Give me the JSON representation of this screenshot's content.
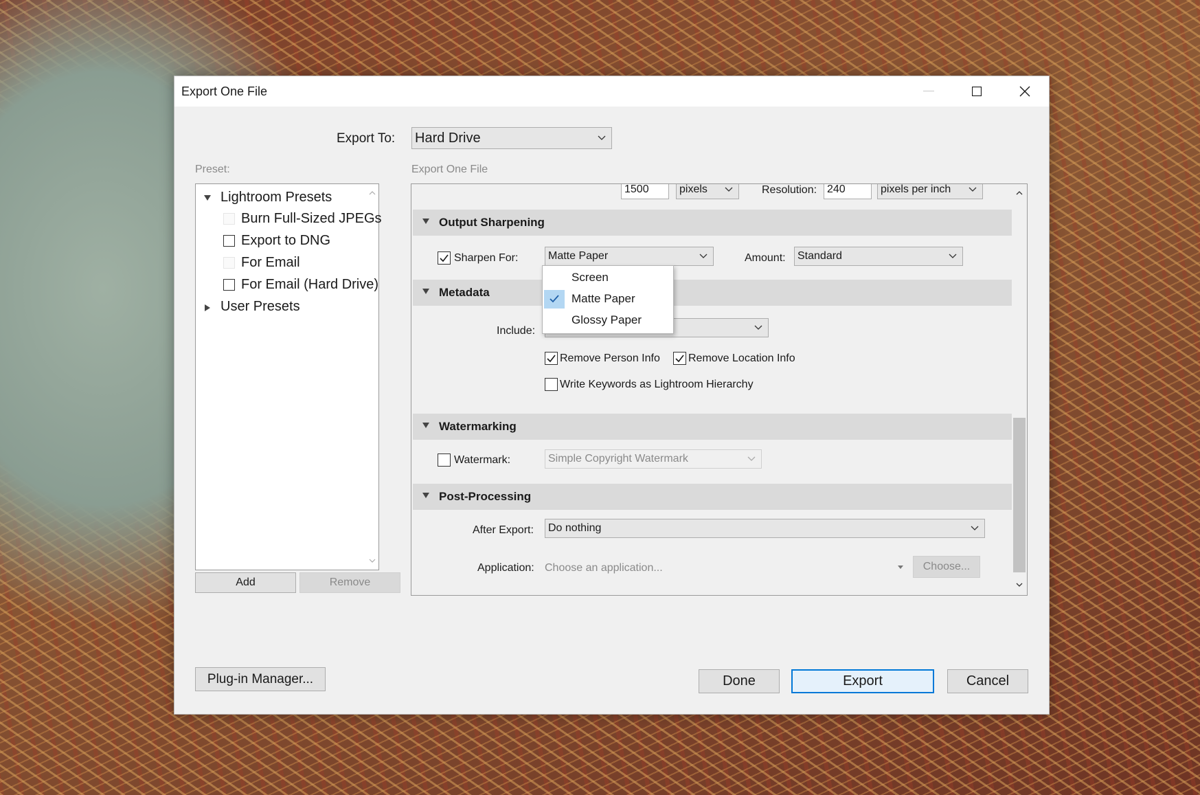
{
  "window": {
    "title": "Export One File"
  },
  "export_to": {
    "label": "Export To:",
    "value": "Hard Drive"
  },
  "preset": {
    "label": "Preset:",
    "groups": [
      {
        "label": "Lightroom Presets",
        "expanded": true
      },
      {
        "label": "User Presets",
        "expanded": false
      }
    ],
    "items": [
      {
        "label": "Burn Full-Sized JPEGs",
        "checked": false
      },
      {
        "label": "Export to DNG",
        "checked": false
      },
      {
        "label": "For Email",
        "checked": false
      },
      {
        "label": "For Email (Hard Drive)",
        "checked": false
      }
    ],
    "add_label": "Add",
    "remove_label": "Remove"
  },
  "settings": {
    "header": "Export One File",
    "size": {
      "value": "1500",
      "units": "pixels",
      "resolution_label": "Resolution:",
      "resolution_value": "240",
      "resolution_units": "pixels per inch"
    },
    "output_sharpening": {
      "title": "Output Sharpening",
      "sharpen_for_label": "Sharpen For:",
      "sharpen_for_checked": true,
      "sharpen_for_value": "Matte Paper",
      "amount_label": "Amount:",
      "amount_value": "Standard",
      "dropdown_options": [
        "Screen",
        "Matte Paper",
        "Glossy Paper"
      ],
      "dropdown_selected": "Matte Paper"
    },
    "metadata": {
      "title": "Metadata",
      "include_label": "Include:",
      "remove_person_label": "Remove Person Info",
      "remove_person_checked": true,
      "remove_location_label": "Remove Location Info",
      "remove_location_checked": true,
      "write_keywords_label": "Write Keywords as Lightroom Hierarchy",
      "write_keywords_checked": false
    },
    "watermarking": {
      "title": "Watermarking",
      "watermark_label": "Watermark:",
      "watermark_checked": false,
      "watermark_value": "Simple Copyright Watermark"
    },
    "post_processing": {
      "title": "Post-Processing",
      "after_export_label": "After Export:",
      "after_export_value": "Do nothing",
      "application_label": "Application:",
      "application_placeholder": "Choose an application...",
      "choose_label": "Choose..."
    }
  },
  "footer": {
    "plugin_manager_label": "Plug-in Manager...",
    "done_label": "Done",
    "export_label": "Export",
    "cancel_label": "Cancel"
  },
  "colors": {
    "accent": "#0078d7",
    "selection": "#b3d7f3",
    "section_header": "#dadada"
  }
}
